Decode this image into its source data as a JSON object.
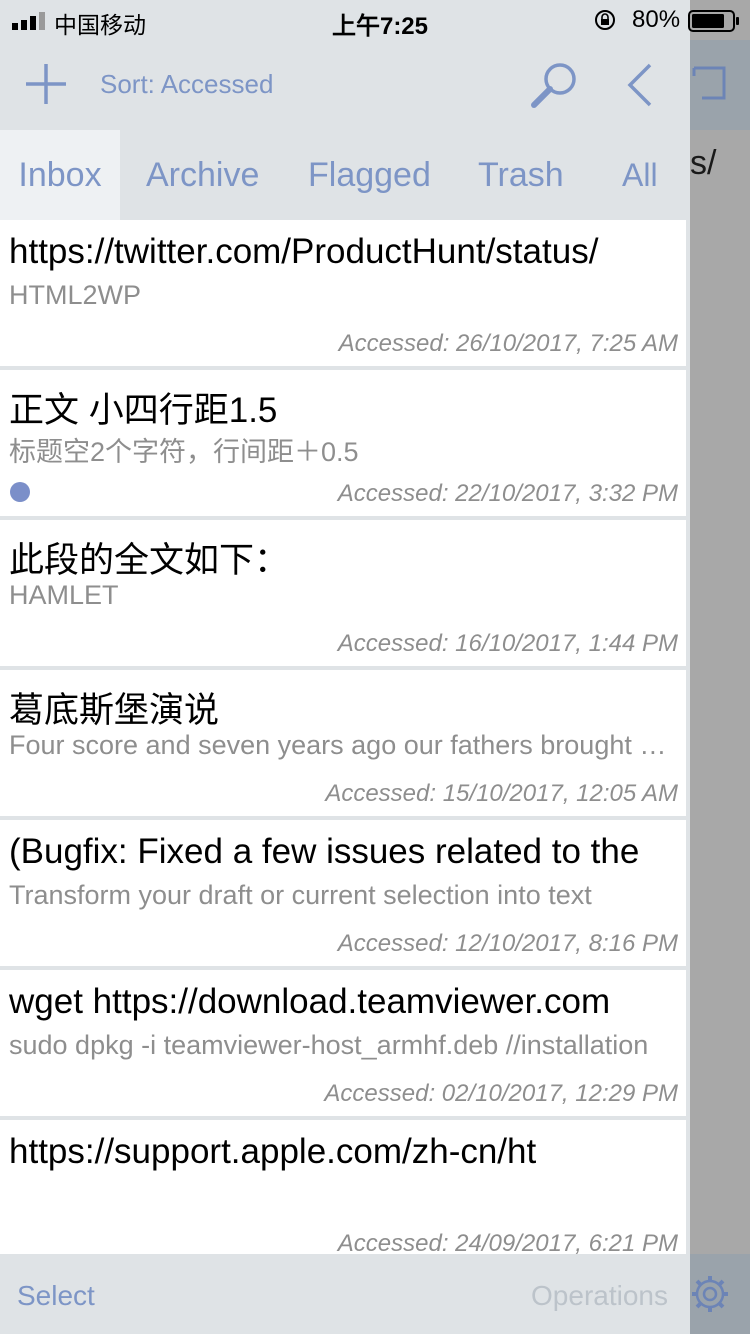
{
  "status_bar": {
    "carrier": "中国移动",
    "time": "上午7:25",
    "battery": "80%"
  },
  "nav": {
    "sort_label": "Sort: Accessed"
  },
  "tabs": [
    {
      "label": "Inbox",
      "active": true
    },
    {
      "label": "Archive",
      "active": false
    },
    {
      "label": "Flagged",
      "active": false
    },
    {
      "label": "Trash",
      "active": false
    },
    {
      "label": "All",
      "active": false
    }
  ],
  "items": [
    {
      "title": "https://twitter.com/ProductHunt/status/",
      "subtitle": "HTML2WP",
      "accessed": "Accessed: 26/10/2017, 7:25 AM",
      "unread": false
    },
    {
      "title": "正文 小四行距1.5",
      "subtitle": "标题空2个字符，行间距＋0.5",
      "accessed": "Accessed: 22/10/2017, 3:32 PM",
      "unread": true
    },
    {
      "title": "此段的全文如下：",
      "subtitle": "HAMLET",
      "accessed": "Accessed: 16/10/2017, 1:44 PM",
      "unread": false
    },
    {
      "title": "葛底斯堡演说",
      "subtitle": "Four score and seven years ago our fathers brought forth",
      "accessed": "Accessed: 15/10/2017, 12:05 AM",
      "unread": false
    },
    {
      "title": "(Bugfix: Fixed a few issues related to the",
      "subtitle": "Transform your draft or current selection into text",
      "accessed": "Accessed: 12/10/2017, 8:16 PM",
      "unread": false
    },
    {
      "title": "wget https://download.teamviewer.com",
      "subtitle": "sudo dpkg -i teamviewer-host_armhf.deb    //installation",
      "accessed": "Accessed: 02/10/2017, 12:29 PM",
      "unread": false
    },
    {
      "title": "https://support.apple.com/zh-cn/ht",
      "subtitle": "",
      "accessed": "Accessed: 24/09/2017, 6:21 PM",
      "unread": false
    }
  ],
  "toolbar": {
    "select_label": "Select",
    "operations_label": "Operations"
  },
  "background": {
    "peek_text": "s/"
  },
  "colors": {
    "accent": "#7d95c6",
    "panel_bg": "#dfe3e6",
    "unread_dot": "#7b8fc9"
  }
}
